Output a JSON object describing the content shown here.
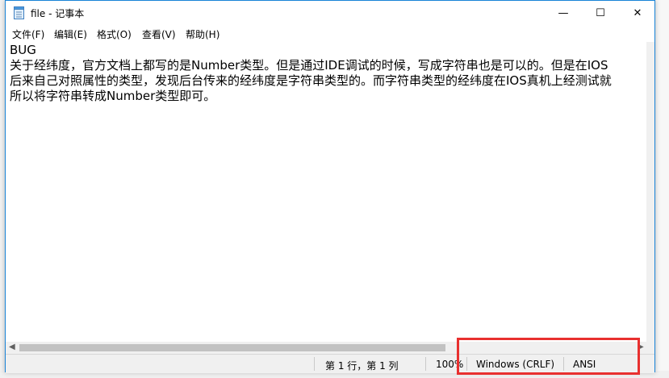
{
  "window": {
    "title": "file - 记事本",
    "min_glyph": "—",
    "max_glyph": "☐",
    "close_glyph": "✕"
  },
  "menu": [
    "文件(F)",
    "编辑(E)",
    "格式(O)",
    "查看(V)",
    "帮助(H)"
  ],
  "editor": {
    "lines": [
      "BUG",
      "关于经纬度，官方文档上都写的是Number类型。但是通过IDE调试的时候，写成字符串也是可以的。但是在IOS",
      "后来自己对照属性的类型，发现后台传来的经纬度是字符串类型的。而字符串类型的经纬度在IOS真机上经测试就",
      "所以将字符串转成Number类型即可。"
    ]
  },
  "scrollbar": {
    "left_arrow": "◀",
    "right_arrow": "▶"
  },
  "status": {
    "position": "第 1 行，第 1 列",
    "zoom": "100%",
    "line_ending": "Windows (CRLF)",
    "encoding": "ANSI"
  },
  "colors": {
    "accent_border": "#1883d7",
    "highlight": "#e8302f"
  }
}
